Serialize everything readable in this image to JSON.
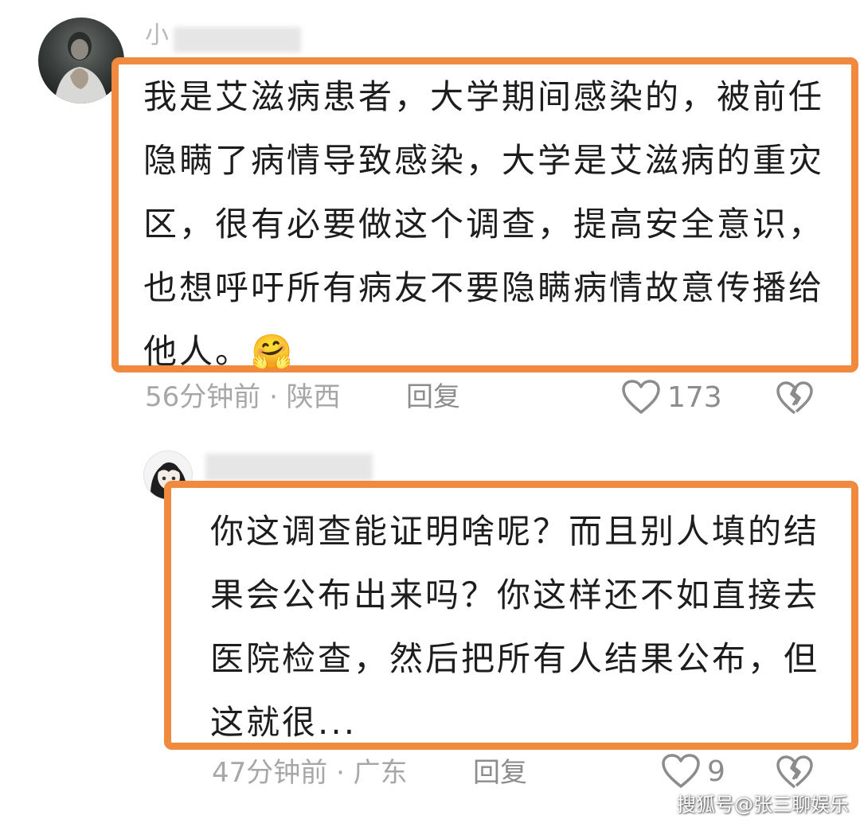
{
  "colors": {
    "highlight_border": "#ef8a3e",
    "meta_text": "#a7a7a7",
    "action_text": "#8c8c8c",
    "body_text": "#1d1d1d"
  },
  "comments": [
    {
      "username": "小",
      "text": "我是艾滋病患者，大学期间感染的，被前任隐瞒了病情导致感染，大学是艾滋病的重灾区，很有必要做这个调查，提高安全意识，也想呼吁所有病友不要隐瞒病情故意传播给他人。🤗",
      "meta": "56分钟前 · 陕西",
      "reply_label": "回复",
      "like_count": "173",
      "like_icon": "heart-outline-icon",
      "dislike_icon": "broken-heart-icon"
    },
    {
      "text": "你这调查能证明啥呢？而且别人填的结果会公布出来吗？你这样还不如直接去医院检查，然后把所有人结果公布，但这就很...",
      "meta": "47分钟前 · 广东",
      "reply_label": "回复",
      "like_count": "9",
      "like_icon": "heart-outline-icon",
      "dislike_icon": "broken-heart-icon"
    }
  ],
  "watermark": "搜狐号@张三聊娱乐"
}
